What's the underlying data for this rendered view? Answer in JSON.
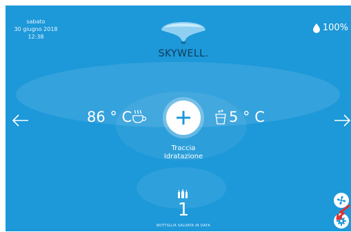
{
  "status": {
    "day": "sabato",
    "date": "30 giugno 2018",
    "time": "12:38",
    "humidity": "100%"
  },
  "brand": {
    "logo_text": "SKYWELL."
  },
  "dispense": {
    "hot_temp": "86 ° C",
    "cold_temp": "5 ° C",
    "add_button": "+",
    "caption_line1": "Traccia",
    "caption_line2": "Idratazione"
  },
  "stats": {
    "bottle_count": "1",
    "bottle_label": "BOTTIGLIA SALVATA IN DATA"
  },
  "icons": {
    "drop": "water-drop-icon",
    "hot": "hot-cup-icon",
    "cold": "cold-water-glass-icon",
    "bottles": "bottles-icon",
    "fan": "fan-icon",
    "settings": "settings-gear-icon"
  },
  "colors": {
    "background": "#1d98d9",
    "text": "#ffffff",
    "logo_text": "#0f3a56",
    "accent": "#1d98d9",
    "cursor": "#e0322b"
  }
}
